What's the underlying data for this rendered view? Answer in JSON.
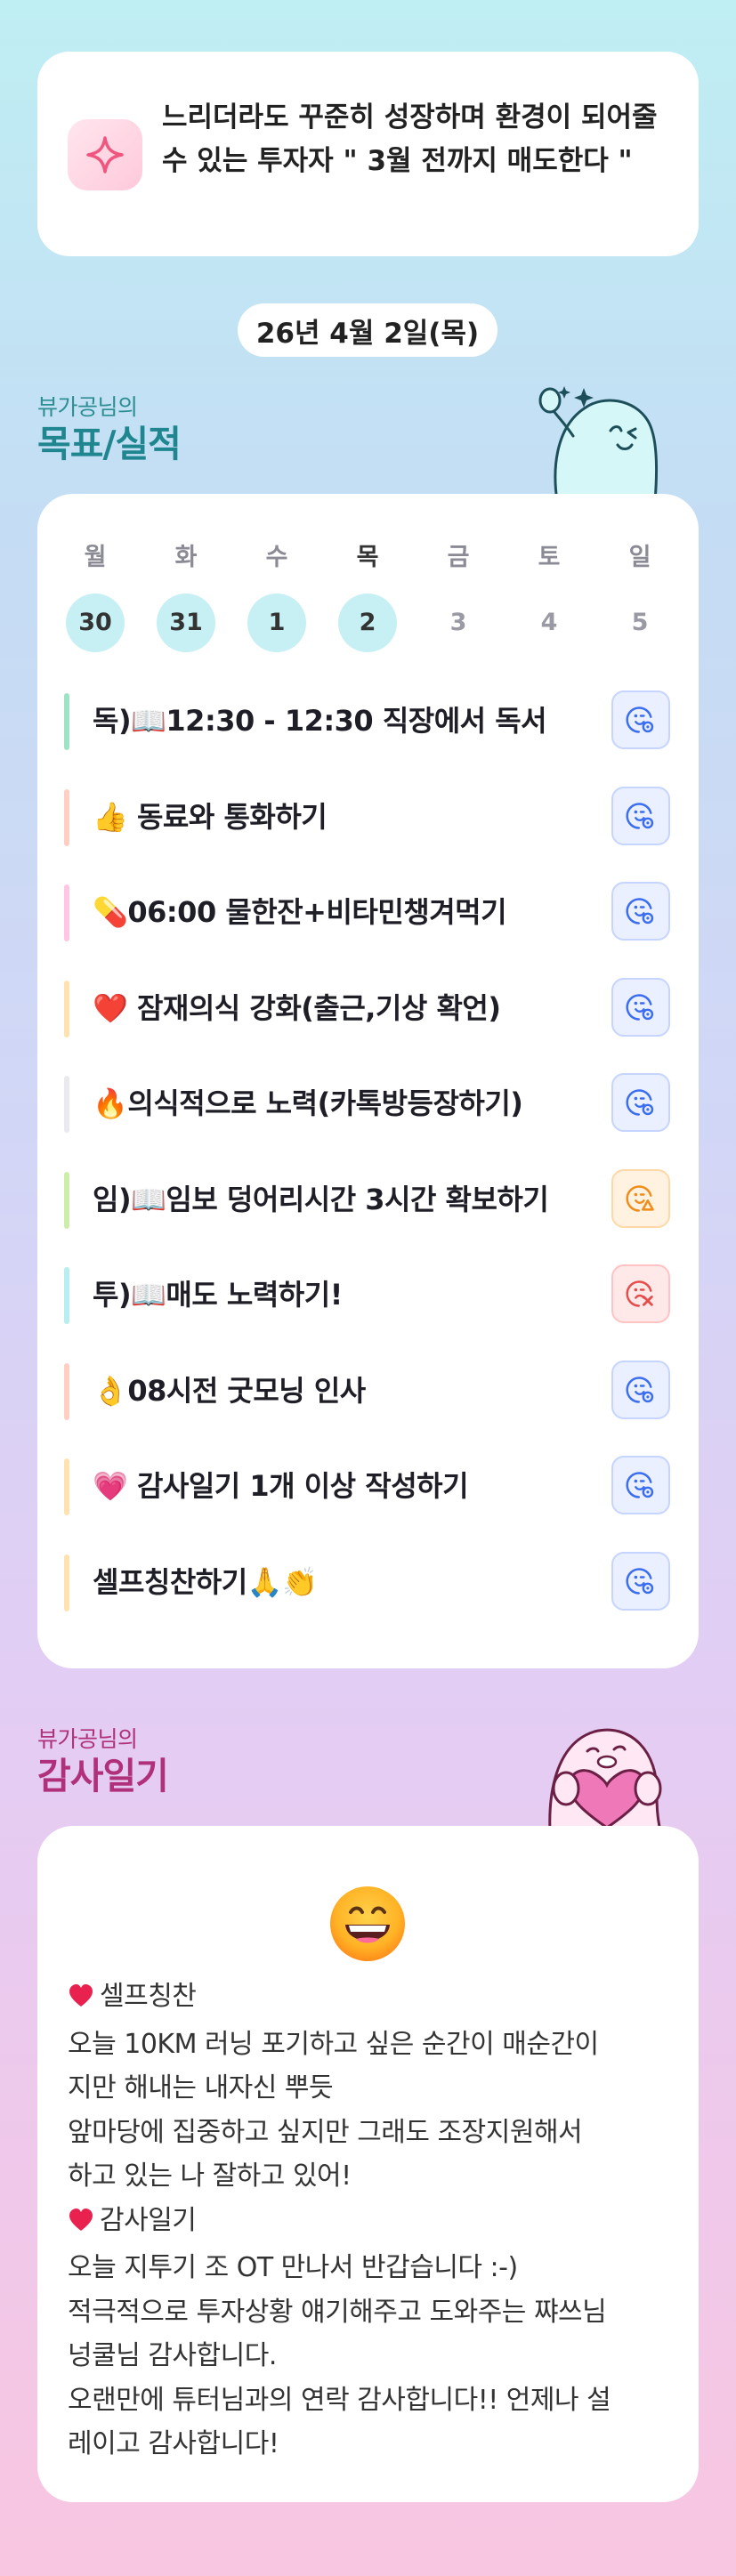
{
  "goal": {
    "text": "느리더라도 꾸준히 성장하며 환경이 되어줄 수 있는 투자자 \" 3월 전까지 매도한다 \"",
    "icon": "sparkle-icon"
  },
  "date": "26년 4월 2일(목)",
  "goals_section": {
    "subtitle": "뷰가공님의",
    "title": "목표/실적"
  },
  "week": [
    {
      "day": "월",
      "num": "30",
      "done": true
    },
    {
      "day": "화",
      "num": "31",
      "done": true
    },
    {
      "day": "수",
      "num": "1",
      "done": true
    },
    {
      "day": "목",
      "num": "2",
      "done": true,
      "current": true
    },
    {
      "day": "금",
      "num": "3",
      "done": false
    },
    {
      "day": "토",
      "num": "4",
      "done": false
    },
    {
      "day": "일",
      "num": "5",
      "done": false
    }
  ],
  "tasks": [
    {
      "label": "독)📖12:30 - 12:30 직장에서 독서",
      "status": "ok",
      "bar_color": "#9fe3c6"
    },
    {
      "label": "👍 동료와 통화하기",
      "status": "ok",
      "bar_color": "#ffcfc4"
    },
    {
      "label": "💊06:00 물한잔+비타민챙겨먹기",
      "status": "ok",
      "bar_color": "#ffc6e3"
    },
    {
      "label": "❤️ 잠재의식 강화(출근,기상 확언)",
      "status": "ok",
      "bar_color": "#ffe2b0"
    },
    {
      "label": "🔥의식적으로 노력(카톡방등장하기)",
      "status": "ok",
      "bar_color": "#e9e9ee"
    },
    {
      "label": "임)📖임보 덩어리시간 3시간 확보하기",
      "status": "warn",
      "bar_color": "#cdeea8"
    },
    {
      "label": "투)📖매도 노력하기!",
      "status": "fail",
      "bar_color": "#b7eef0"
    },
    {
      "label": "👌08시전 굿모닝 인사",
      "status": "ok",
      "bar_color": "#ffcfc4"
    },
    {
      "label": "💗 감사일기 1개 이상 작성하기",
      "status": "ok",
      "bar_color": "#ffe2b0"
    },
    {
      "label": "셀프칭찬하기🙏👏",
      "status": "ok",
      "bar_color": "#ffe2b0"
    }
  ],
  "gratitude_section": {
    "subtitle": "뷰가공님의",
    "title": "감사일기"
  },
  "diary": {
    "mood": "grinning-face",
    "lines": [
      {
        "heart": true,
        "text": "셀프칭찬"
      },
      {
        "heart": false,
        "text": "오늘 10KM 러닝 포기하고 싶은 순간이 매순간이"
      },
      {
        "heart": false,
        "text": "지만 해내는 내자신 뿌듯"
      },
      {
        "heart": false,
        "text": "앞마당에 집중하고 싶지만 그래도 조장지원해서"
      },
      {
        "heart": false,
        "text": "하고 있는 나 잘하고 있어!"
      },
      {
        "heart": true,
        "text": "감사일기"
      },
      {
        "heart": false,
        "text": "오늘 지투기 조 OT 만나서 반갑습니다 :-)"
      },
      {
        "heart": false,
        "text": "적극적으로 투자상황 얘기해주고 도와주는 쨔쓰님"
      },
      {
        "heart": false,
        "text": "넝쿨님 감사합니다."
      },
      {
        "heart": false,
        "text": "오랜만에 튜터님과의 연락 감사합니다!! 언제나 설"
      },
      {
        "heart": false,
        "text": "레이고 감사합니다!"
      }
    ]
  }
}
